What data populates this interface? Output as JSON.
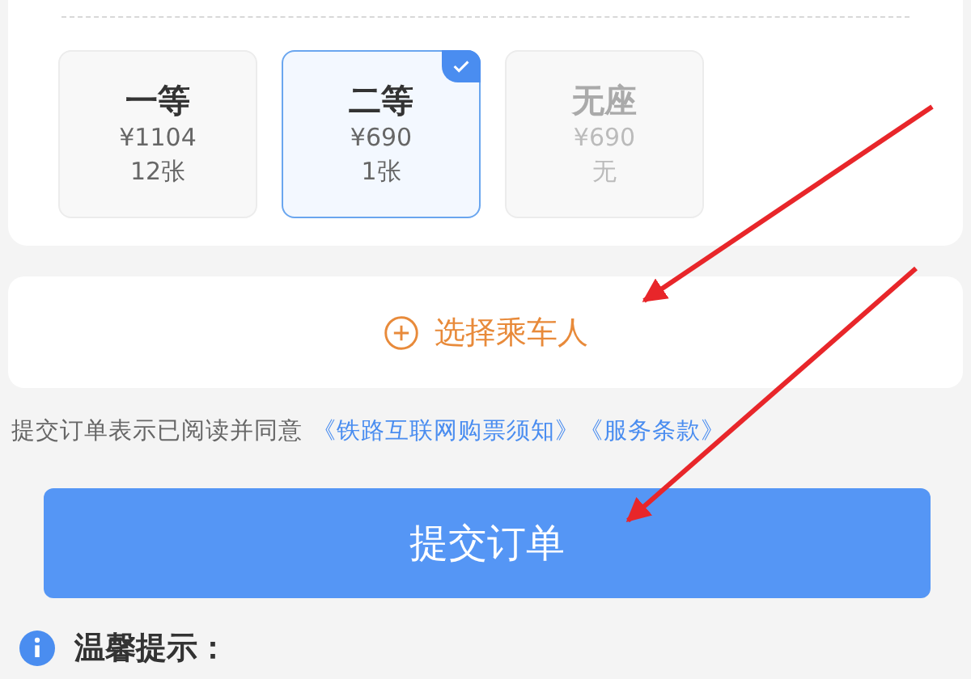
{
  "seats": [
    {
      "label": "一等",
      "price": "¥1104",
      "count": "12张",
      "selected": false,
      "disabled": false
    },
    {
      "label": "二等",
      "price": "¥690",
      "count": "1张",
      "selected": true,
      "disabled": false
    },
    {
      "label": "无座",
      "price": "¥690",
      "count": "无",
      "selected": false,
      "disabled": true
    }
  ],
  "passenger_button": {
    "label": "选择乘车人"
  },
  "agreement": {
    "text": "提交订单表示已阅读并同意",
    "links": [
      "《铁路互联网购票须知》",
      "《服务条款》"
    ]
  },
  "submit_button": {
    "label": "提交订单"
  },
  "tip": {
    "title": "温馨提示："
  }
}
